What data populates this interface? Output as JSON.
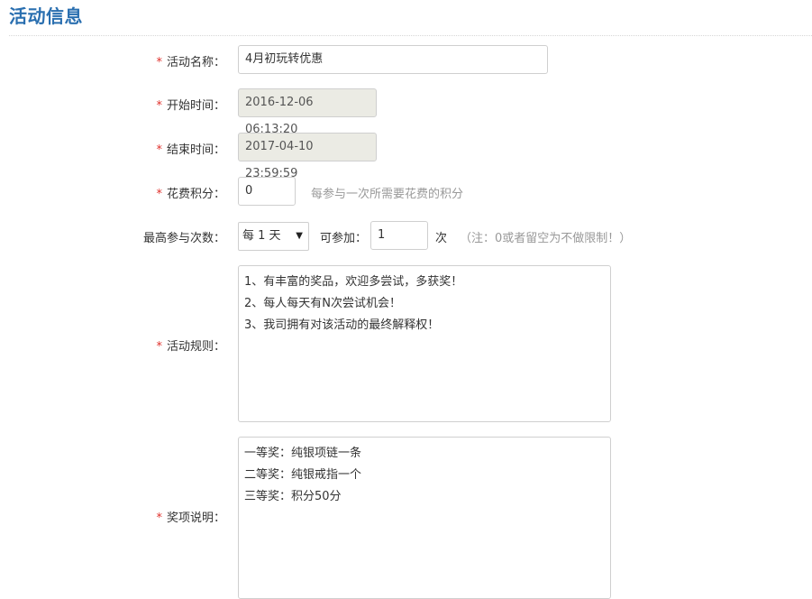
{
  "section": {
    "title": "活动信息"
  },
  "form": {
    "required_mark": "*",
    "name": {
      "label": "活动名称：",
      "value": "4月初玩转优惠"
    },
    "start_time": {
      "label": "开始时间：",
      "value": "2016-12-06 06:13:20"
    },
    "end_time": {
      "label": "结束时间：",
      "value": "2017-04-10 23:59:59"
    },
    "cost_points": {
      "label": "花费积分：",
      "value": "0",
      "hint": "每参与一次所需要花费的积分"
    },
    "max_participation": {
      "label": "最高参与次数：",
      "period_selected": "每 1 天",
      "can_join_label": "可参加：",
      "count_value": "1",
      "unit": "次",
      "note": "（注：0或者留空为不做限制！）"
    },
    "rules": {
      "label": "活动规则：",
      "lines": [
        "1、有丰富的奖品，欢迎多尝试，多获奖！",
        "2、每人每天有N次尝试机会！",
        "3、我司拥有对该活动的最终解释权！"
      ]
    },
    "prizes": {
      "label": "奖项说明：",
      "lines": [
        "一等奖：纯银项链一条",
        "二等奖：纯银戒指一个",
        "三等奖：积分50分"
      ]
    }
  }
}
